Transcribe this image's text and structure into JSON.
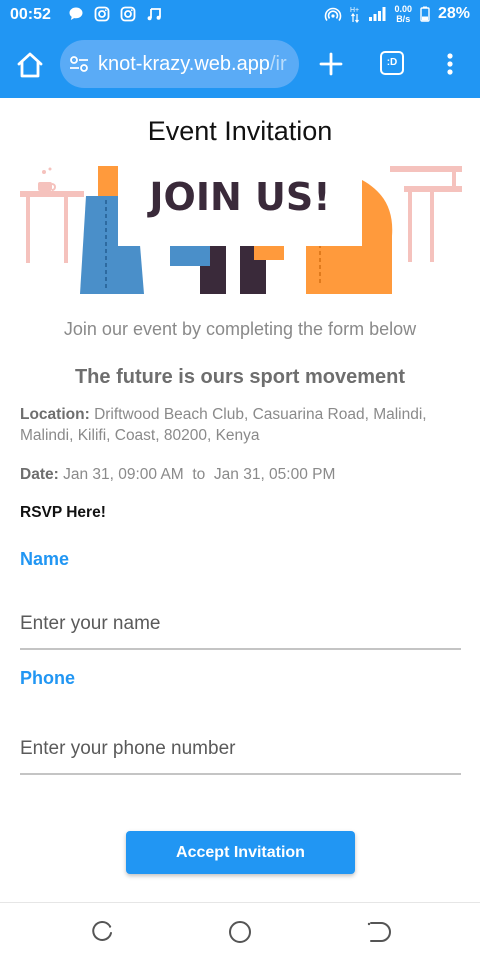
{
  "status_bar": {
    "time": "00:52",
    "net_speed_top": "0.00",
    "net_speed_bottom": "B/s",
    "battery": "28%",
    "icons_left": [
      "chat-bubble-icon",
      "instagram-icon",
      "instagram-icon",
      "music-note-icon"
    ],
    "icons_right": [
      "hotspot-icon",
      "data-arrows-icon",
      "signal-icon",
      "battery-icon"
    ]
  },
  "browser": {
    "url_main": "knot-krazy.web.app",
    "url_rest": "/ir",
    "tab_count": ":D"
  },
  "page": {
    "title": "Event Invitation",
    "banner_text": "JOIN US!",
    "subtitle": "Join our event by completing the form below",
    "event_name": "The future is ours sport movement",
    "location_label": "Location:",
    "location_value": "Driftwood Beach Club, Casuarina Road, Malindi, Malindi, Kilifi, Coast, 80200, Kenya",
    "date_label": "Date:",
    "date_start": "Jan 31, 09:00 AM",
    "date_sep": "to",
    "date_end": "Jan 31, 05:00 PM",
    "rsvp": "RSVP Here!",
    "form": {
      "name_label": "Name",
      "name_placeholder": "Enter your name",
      "phone_label": "Phone",
      "phone_placeholder": "Enter your phone number",
      "submit_label": "Accept Invitation"
    }
  },
  "colors": {
    "accent": "#2196f3",
    "banner_orange": "#ff9a3c",
    "banner_blue": "#4a8fc9",
    "banner_dark": "#3a2a3a",
    "banner_pink": "#f5c2bd"
  }
}
